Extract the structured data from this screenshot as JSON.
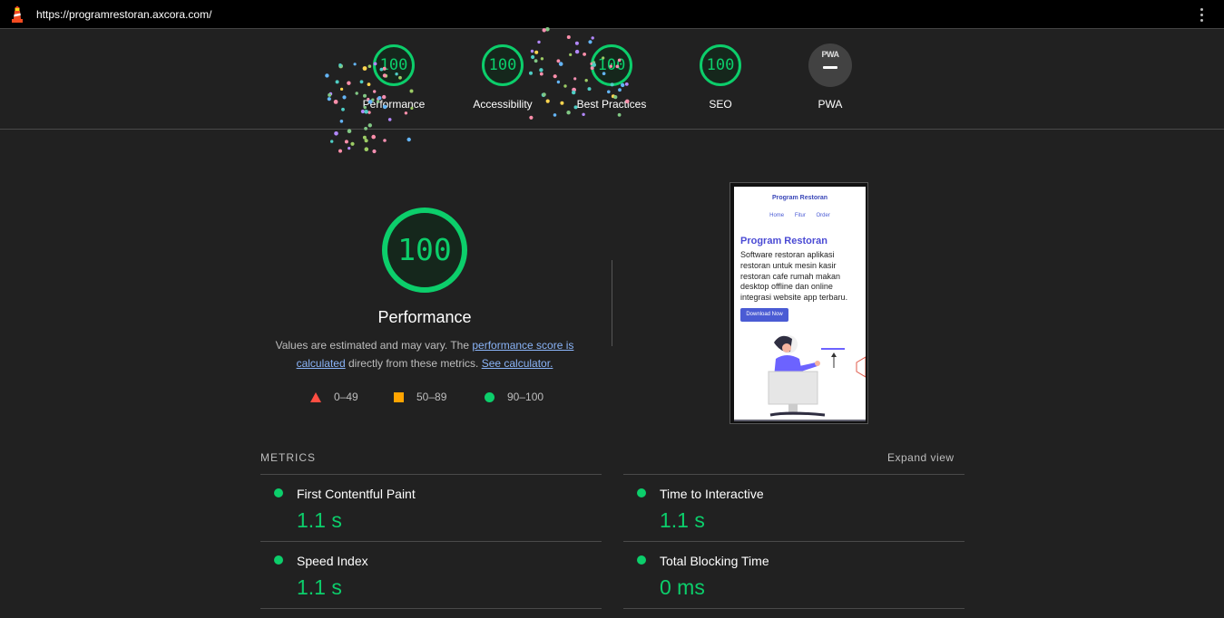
{
  "url_bar": {
    "url": "https://programrestoran.axcora.com/"
  },
  "gauges": [
    {
      "score": "100",
      "label": "Performance"
    },
    {
      "score": "100",
      "label": "Accessibility"
    },
    {
      "score": "100",
      "label": "Best Practices"
    },
    {
      "score": "100",
      "label": "SEO"
    },
    {
      "score": "",
      "label": "PWA",
      "badge_text": "PWA"
    }
  ],
  "performance": {
    "score": "100",
    "title": "Performance",
    "desc_prefix": "Values are estimated and may vary. The ",
    "score_link": "performance score is calculated",
    "desc_middle": " directly from these metrics. ",
    "calculator_link": "See calculator."
  },
  "legend": [
    {
      "range": "0–49",
      "color": "#ff4e42",
      "shape": "triangle"
    },
    {
      "range": "50–89",
      "color": "#ffa400",
      "shape": "square"
    },
    {
      "range": "90–100",
      "color": "#0cce6b",
      "shape": "circle"
    }
  ],
  "screenshot": {
    "brand": "Program Restoran",
    "nav": [
      "Home",
      "Fitur",
      "Order"
    ],
    "heading": "Program Restoran",
    "paragraph": "Software restoran aplikasi restoran untuk mesin kasir restoran cafe rumah makan desktop offline dan online integrasi website app terbaru.",
    "button": "Download Now"
  },
  "metrics": {
    "header": "METRICS",
    "expand_label": "Expand view",
    "items": [
      {
        "title": "First Contentful Paint",
        "value": "1.1 s"
      },
      {
        "title": "Time to Interactive",
        "value": "1.1 s"
      },
      {
        "title": "Speed Index",
        "value": "1.1 s"
      },
      {
        "title": "Total Blocking Time",
        "value": "0 ms"
      }
    ]
  },
  "colors": {
    "pass": "#0cce6b",
    "average": "#ffa400",
    "fail": "#ff4e42",
    "background": "#212121",
    "link": "#8ab4f8"
  }
}
